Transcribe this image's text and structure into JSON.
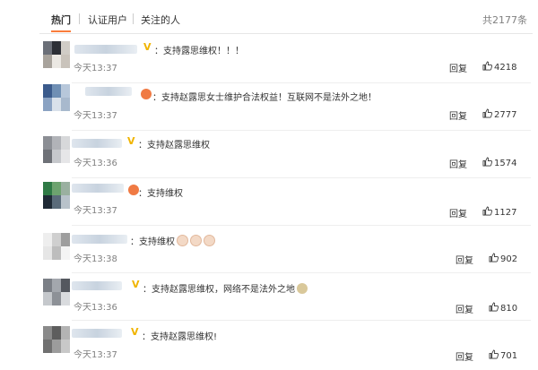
{
  "tabs": {
    "hot": "热门",
    "verified": "认证用户",
    "following": "关注的人"
  },
  "total_count": "共2177条",
  "comments": [
    {
      "text": "：支持露思维权！！！",
      "time": "今天13:37",
      "reply": "回复",
      "likes": "4218",
      "badge": "V",
      "avatar": [
        "#6b6f78",
        "#2c2f36",
        "#d0ccc6",
        "#a8a39c",
        "#ebe8e3",
        "#c9c3bb"
      ]
    },
    {
      "text": "：支持赵露思女士维护合法权益！互联网不是法外之地！",
      "time": "今天13:37",
      "reply": "回复",
      "likes": "2777",
      "badge": "",
      "avatar": [
        "#3b5b8c",
        "#6f8fb4",
        "#b7c7da",
        "#8aa2c2",
        "#d9e1ea",
        "#a8b9cd"
      ]
    },
    {
      "text": "：支持赵露思维权",
      "time": "今天13:36",
      "reply": "回复",
      "likes": "1574",
      "badge": "V",
      "avatar": [
        "#8b8e94",
        "#b1b3b8",
        "#d7d8da",
        "#6e7177",
        "#c6c8cc",
        "#e6e6e8"
      ]
    },
    {
      "text": "：支持维权",
      "time": "今天13:37",
      "reply": "回复",
      "likes": "1127",
      "badge": "",
      "avatar": [
        "#2f7a46",
        "#6da36f",
        "#9ab0a0",
        "#1f2a36",
        "#5a6b7a",
        "#b8c2ca"
      ]
    },
    {
      "text": "：支持维权",
      "time": "今天13:38",
      "reply": "回复",
      "likes": "902",
      "badge": "",
      "avatar": [
        "#eeeeee",
        "#cfcfcf",
        "#9e9e9e",
        "#e6e6e6",
        "#bdbdbd",
        "#f4f4f4"
      ]
    },
    {
      "text": "：支持赵露思维权，网络不是法外之地",
      "time": "今天13:36",
      "reply": "回复",
      "likes": "810",
      "badge": "V",
      "avatar": [
        "#7b7f86",
        "#a3a7ad",
        "#54585f",
        "#c5c8cc",
        "#8d9197",
        "#d9dbde"
      ]
    },
    {
      "text": "：支持赵露思维权!",
      "time": "今天13:37",
      "reply": "回复",
      "likes": "701",
      "badge": "V",
      "avatar": [
        "#8a8a8a",
        "#5d5d5d",
        "#b3b3b3",
        "#707070",
        "#9c9c9c",
        "#c8c8c8"
      ]
    }
  ],
  "colors": {
    "accent": "#fa7d3c",
    "vip": "#f0b400",
    "muted": "#808080"
  }
}
